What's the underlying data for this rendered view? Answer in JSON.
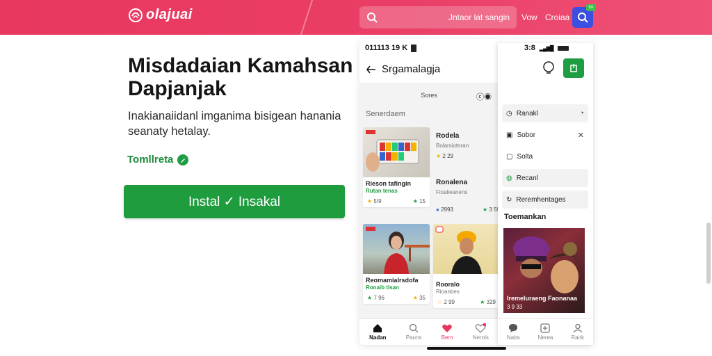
{
  "header": {
    "logo_text": "olajuai",
    "search_placeholder": "Jntaor lat sangin",
    "nav_view": "Vow",
    "nav_other": "Croiaa",
    "search_badge": "Im"
  },
  "hero": {
    "title": "Misdadaian Kamahsan Dapjanjak",
    "subtitle": "Inakianaiidanl imganima bisigean hanania seanaty hetalay.",
    "link_text": "Tomllreta",
    "install_label": "Instal ✓ Insakal"
  },
  "phone": {
    "status_time": "011113 19 K",
    "header_title": "Srgamalagja",
    "tabs_label": "Sores",
    "tabs_icons": "ⓒ◉",
    "section_title": "Senerdaem",
    "cards": [
      {
        "title": "Rieson tafingin",
        "sub": "Rutan tenas",
        "meta_left": "5!9",
        "meta_right": "15"
      },
      {
        "title": "Reomamialrsdofa",
        "sub": "Ronaib tlsan",
        "meta_left": "7 96",
        "meta_right": "35"
      }
    ],
    "rcards": [
      {
        "title": "Rodela",
        "sub": "Bolarsiotnran",
        "meta_left": "2 29",
        "meta_right": ""
      },
      {
        "title": "Ronalena",
        "sub": "Fioalieanens",
        "meta_left": "2993",
        "meta_right": "3 59"
      },
      {
        "title": "Rooralo",
        "sub": "Rioanbes",
        "meta_left": "2 99",
        "meta_right": "329"
      }
    ],
    "bottom_nav": [
      {
        "label": "Nadan",
        "icon": "home-icon"
      },
      {
        "label": "Pauns",
        "icon": "search-icon"
      },
      {
        "label": "Bern",
        "icon": "heart-icon"
      },
      {
        "label": "Nerols",
        "icon": "chat-icon"
      }
    ]
  },
  "drawer": {
    "status_time": "3:8",
    "items": [
      {
        "label": "Ranakl",
        "icon": "clock-icon",
        "right": "◔"
      },
      {
        "label": "Sobor",
        "icon": "doc-icon",
        "right": "✕"
      },
      {
        "label": "Solta",
        "icon": "save-icon",
        "right": ""
      },
      {
        "label": "Recanl",
        "icon": "recent-icon",
        "right": ""
      },
      {
        "label": "Reremhentages",
        "icon": "history-icon",
        "right": ""
      }
    ],
    "section_title": "Toemankan",
    "banner_title": "Iremeluraeng Faonanaa",
    "banner_sub": "3 9 33",
    "bottom_nav": [
      {
        "label": "Nabs",
        "icon": "chat-icon"
      },
      {
        "label": "Nerea",
        "icon": "add-icon"
      },
      {
        "label": "Rairk",
        "icon": "profile-icon"
      }
    ]
  },
  "colors": {
    "brand": "#e8385f",
    "install": "#1f9d3e",
    "search_button": "#3b4fe0"
  }
}
